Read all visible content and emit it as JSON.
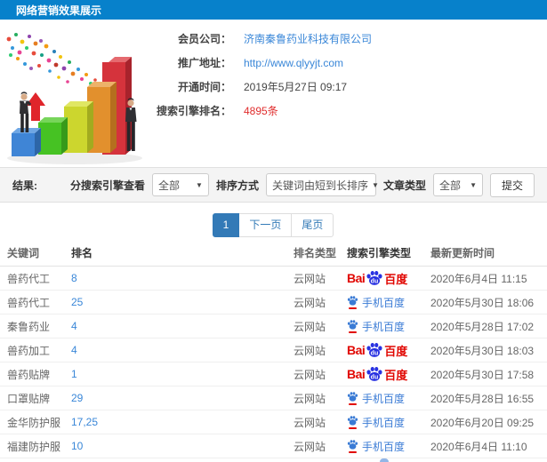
{
  "header": {
    "title": "网络营销效果展示"
  },
  "member": {
    "fields": [
      {
        "label": "会员公司：",
        "value": "济南秦鲁药业科技有限公司",
        "type": "link"
      },
      {
        "label": "推广地址：",
        "value": "http://www.qlyyjt.com",
        "type": "link"
      },
      {
        "label": "开通时间：",
        "value": "2019年5月27日 09:17",
        "type": "text"
      },
      {
        "label": "搜索引擎排名：",
        "value": "4895条",
        "type": "highlight"
      }
    ]
  },
  "filters": {
    "result_label": "结果:",
    "engine_label": "分搜索引擎查看",
    "engine_value": "全部",
    "sort_label": "排序方式",
    "sort_value": "关键词由短到长排序",
    "article_label": "文章类型",
    "article_value": "全部",
    "submit_label": "提交"
  },
  "pagination": {
    "current": "1",
    "next_label": "下一页",
    "last_label": "尾页"
  },
  "table": {
    "columns": [
      "关键词",
      "排名",
      "排名类型",
      "搜索引擎类型",
      "最新更新时间"
    ],
    "engine_display": {
      "baidu_bai": "Bai",
      "baidu_du": "du",
      "baidu_cn": "百度",
      "mobile_text": "手机百度"
    },
    "rows": [
      {
        "keyword": "兽药代工",
        "rank": "8",
        "rank_type": "云网站",
        "engine": "baidu",
        "time": "2020年6月4日 11:15"
      },
      {
        "keyword": "兽药代工",
        "rank": "25",
        "rank_type": "云网站",
        "engine": "mobile-baidu",
        "time": "2020年5月30日 18:06"
      },
      {
        "keyword": "秦鲁药业",
        "rank": "4",
        "rank_type": "云网站",
        "engine": "mobile-baidu",
        "time": "2020年5月28日 17:02"
      },
      {
        "keyword": "兽药加工",
        "rank": "4",
        "rank_type": "云网站",
        "engine": "baidu",
        "time": "2020年5月30日 18:03"
      },
      {
        "keyword": "兽药贴牌",
        "rank": "1",
        "rank_type": "云网站",
        "engine": "baidu",
        "time": "2020年5月30日 17:58"
      },
      {
        "keyword": "口罩贴牌",
        "rank": "29",
        "rank_type": "云网站",
        "engine": "mobile-baidu",
        "time": "2020年5月28日 16:55"
      },
      {
        "keyword": "金华防护服",
        "rank": "17,25",
        "rank_type": "云网站",
        "engine": "mobile-baidu",
        "time": "2020年6月20日 09:25"
      },
      {
        "keyword": "福建防护服",
        "rank": "10",
        "rank_type": "云网站",
        "engine": "mobile-baidu",
        "time": "2020年6月4日 11:10"
      }
    ]
  },
  "icons": {
    "caret": "▼",
    "baidu_paw": "paw-print",
    "up_arrow": "growth-arrow"
  },
  "colors": {
    "header_bg": "#0781cb",
    "pagination_active": "#337ab7",
    "link_blue": "#3a87d8",
    "highlight_red": "#e02d2d",
    "baidu_red": "#e10601",
    "baidu_blue": "#2932e1",
    "mobile_blue": "#3a7bd5"
  }
}
